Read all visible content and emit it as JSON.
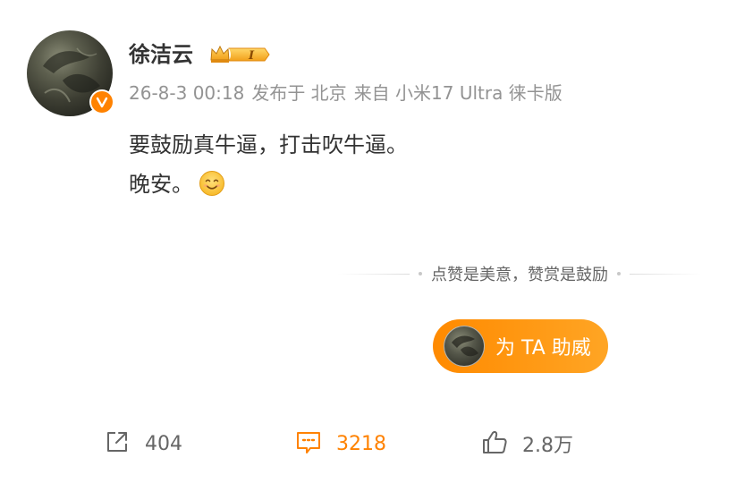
{
  "post": {
    "username": "徐洁云",
    "level_badge_text": "I",
    "meta": {
      "time": "26-8-3 00:18",
      "location": "发布于 北京",
      "device": "来自 小米17 Ultra 徕卡版"
    },
    "content_lines": [
      "要鼓励真牛逼，打击吹牛逼。",
      "晚安。"
    ],
    "emoji": "smile-emoji"
  },
  "reward": {
    "divider_text": "点赞是美意，赞赏是鼓励",
    "button_label": "为 TA 助威"
  },
  "actions": {
    "repost_count": "404",
    "comment_count": "3218",
    "like_count": "2.8万"
  },
  "colors": {
    "accent": "#ff8200",
    "text": "#333333",
    "meta": "#939393",
    "icon": "#666666"
  },
  "icons": [
    "verified-v-icon",
    "crown-level-badge-icon",
    "repost-icon",
    "comment-icon",
    "like-thumb-icon"
  ]
}
